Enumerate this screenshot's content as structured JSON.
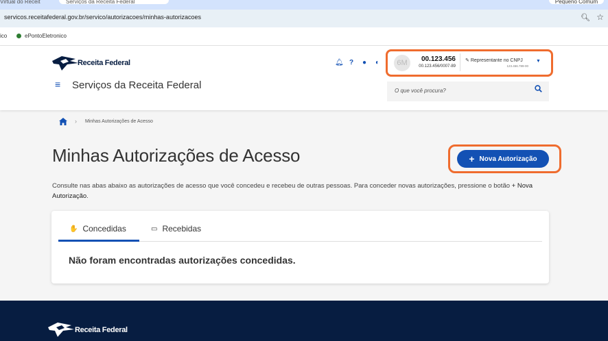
{
  "browser": {
    "tabs": [
      "Virtual do Receit",
      "Serviços da Receita Federal"
    ],
    "top_right_button": "Pequeno Comum",
    "url": "servicos.receitafederal.gov.br/servico/autorizacoes/minhas-autorizacoes",
    "bookmarks": [
      "ico",
      "ePontoEletronico"
    ]
  },
  "header": {
    "logo_text": "Receita Federal",
    "site_title": "Serviços da Receita Federal",
    "user": {
      "avatar_initials": "6M",
      "cnpj_short": "00.123.456",
      "cnpj_full": "00.123.456/0007-89",
      "role_label": "Representante no CNPJ",
      "role_sub": "123.456.789-00"
    },
    "search_placeholder": "O que você procura?"
  },
  "breadcrumb": {
    "current": "Minhas Autorizações de Acesso"
  },
  "page": {
    "title": "Minhas Autorizações de Acesso",
    "new_button": "Nova Autorização",
    "description_before": "Consulte nas abas abaixo as autorizações de acesso que você concedeu e recebeu de outras pessoas. Para conceder novas autorizações, pressione o botão",
    "description_button": "+ Nova Autorização",
    "tabs": [
      "Concedidas",
      "Recebidas"
    ],
    "empty_message": "Não foram encontradas autorizações concedidas."
  },
  "footer": {
    "logo_text": "Receita Federal"
  },
  "colors": {
    "primary": "#1351b4",
    "highlight": "#ef6c2e",
    "footer": "#071d41"
  }
}
